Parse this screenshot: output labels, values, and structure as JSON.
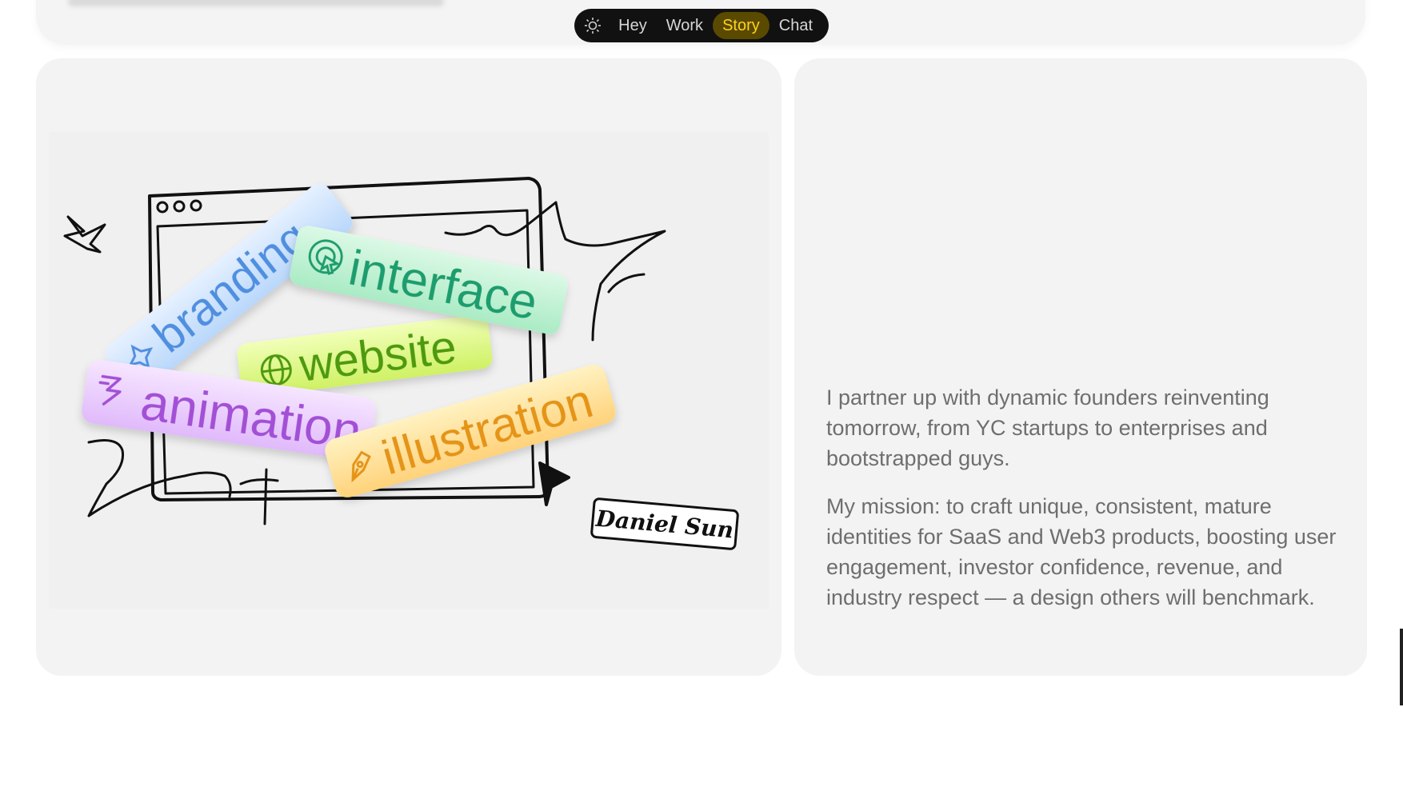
{
  "nav": {
    "theme_icon": "sun-icon",
    "items": [
      {
        "label": "Hey"
      },
      {
        "label": "Work"
      },
      {
        "label": "Story"
      },
      {
        "label": "Chat"
      }
    ],
    "active_color": "#ffd21f"
  },
  "illustration": {
    "tags": [
      {
        "label": "branding",
        "icon": "sparkle-icon",
        "color": "#4f8fe0"
      },
      {
        "label": "interface",
        "icon": "cursor-icon",
        "color": "#1f9d6e"
      },
      {
        "label": "website",
        "icon": "globe-icon",
        "color": "#4d9a10"
      },
      {
        "label": "animation",
        "icon": "bolt-icon",
        "color": "#a34fd6"
      },
      {
        "label": "illustration",
        "icon": "pen-icon",
        "color": "#e59418"
      }
    ],
    "signature": "Daniel Sun"
  },
  "story": {
    "paragraph_1": "I partner up with dynamic founders reinventing tomorrow, from YC startups to enterprises and bootstrapped guys.",
    "paragraph_2": "My mission: to craft unique, consistent, mature identities for SaaS and Web3 products, boosting user engagement, investor confidence, revenue, and industry respect — a design others will benchmark."
  }
}
